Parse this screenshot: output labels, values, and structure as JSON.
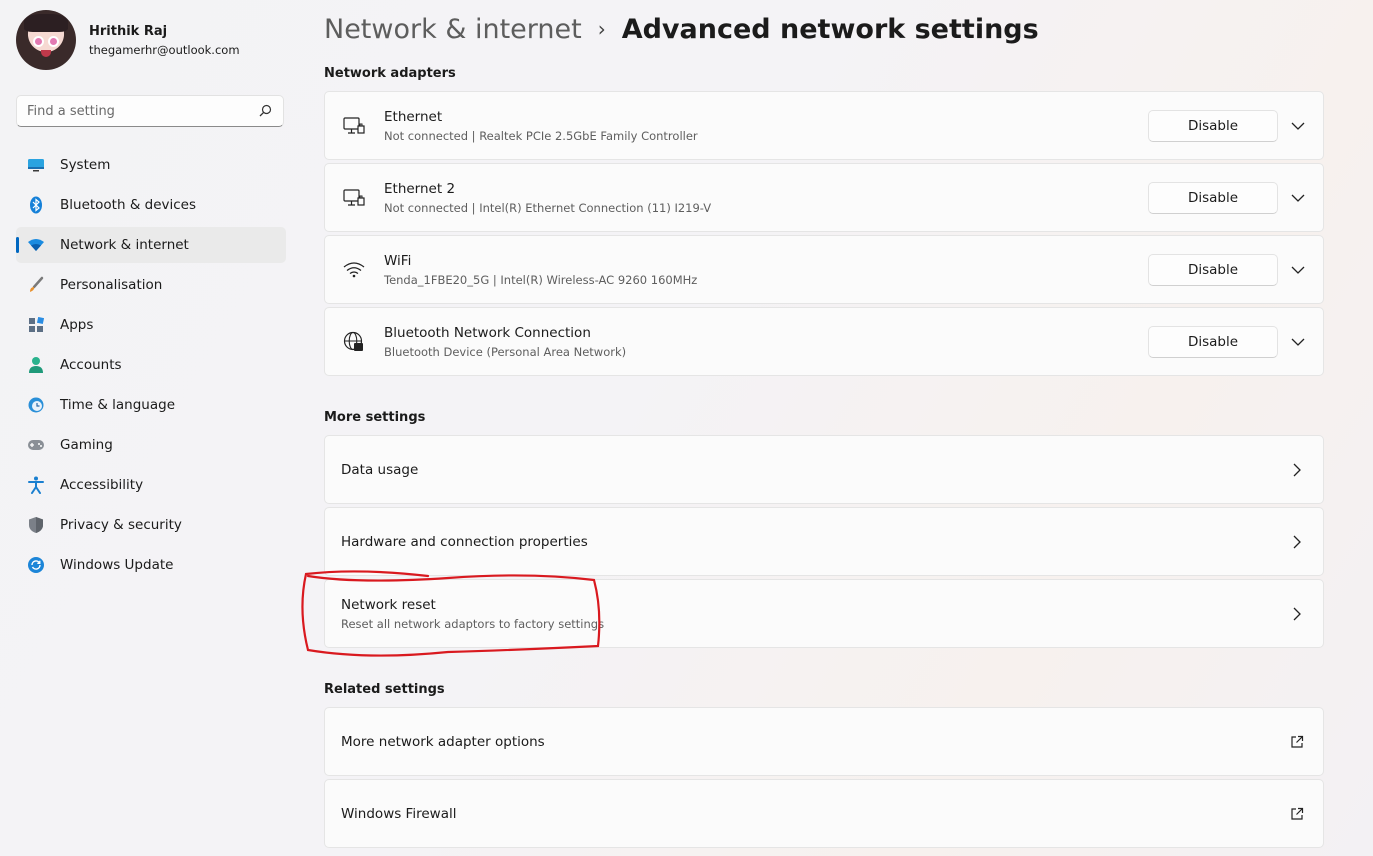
{
  "user": {
    "name": "Hrithik Raj",
    "email": "thegamerhr@outlook.com"
  },
  "search": {
    "placeholder": "Find a setting"
  },
  "nav": [
    {
      "label": "System",
      "icon": "monitor-icon"
    },
    {
      "label": "Bluetooth & devices",
      "icon": "bluetooth-icon"
    },
    {
      "label": "Network & internet",
      "icon": "wifi-icon",
      "active": true
    },
    {
      "label": "Personalisation",
      "icon": "brush-icon"
    },
    {
      "label": "Apps",
      "icon": "apps-icon"
    },
    {
      "label": "Accounts",
      "icon": "person-icon"
    },
    {
      "label": "Time & language",
      "icon": "clock-globe-icon"
    },
    {
      "label": "Gaming",
      "icon": "gamepad-icon"
    },
    {
      "label": "Accessibility",
      "icon": "accessibility-icon"
    },
    {
      "label": "Privacy & security",
      "icon": "shield-icon"
    },
    {
      "label": "Windows Update",
      "icon": "update-icon"
    }
  ],
  "breadcrumb": {
    "parent": "Network & internet",
    "separator": "›",
    "current": "Advanced network settings"
  },
  "sections": {
    "adapters": "Network adapters",
    "more": "More settings",
    "related": "Related settings"
  },
  "adapters": [
    {
      "title": "Ethernet",
      "subtitle": "Not connected | Realtek PCIe 2.5GbE Family Controller",
      "button": "Disable",
      "icon": "ethernet-icon"
    },
    {
      "title": "Ethernet 2",
      "subtitle": "Not connected | Intel(R) Ethernet Connection (11) I219-V",
      "button": "Disable",
      "icon": "ethernet-icon"
    },
    {
      "title": "WiFi",
      "subtitle": "Tenda_1FBE20_5G | Intel(R) Wireless-AC 9260 160MHz",
      "button": "Disable",
      "icon": "wifi-icon"
    },
    {
      "title": "Bluetooth Network Connection",
      "subtitle": "Bluetooth Device (Personal Area Network)",
      "button": "Disable",
      "icon": "globe-network-icon"
    }
  ],
  "more_settings": [
    {
      "title": "Data usage"
    },
    {
      "title": "Hardware and connection properties"
    },
    {
      "title": "Network reset",
      "subtitle": "Reset all network adaptors to factory settings",
      "highlighted": true
    }
  ],
  "related_settings": [
    {
      "title": "More network adapter options"
    },
    {
      "title": "Windows Firewall"
    }
  ],
  "colors": {
    "accent": "#0067c0",
    "annotation": "#d9191f"
  }
}
